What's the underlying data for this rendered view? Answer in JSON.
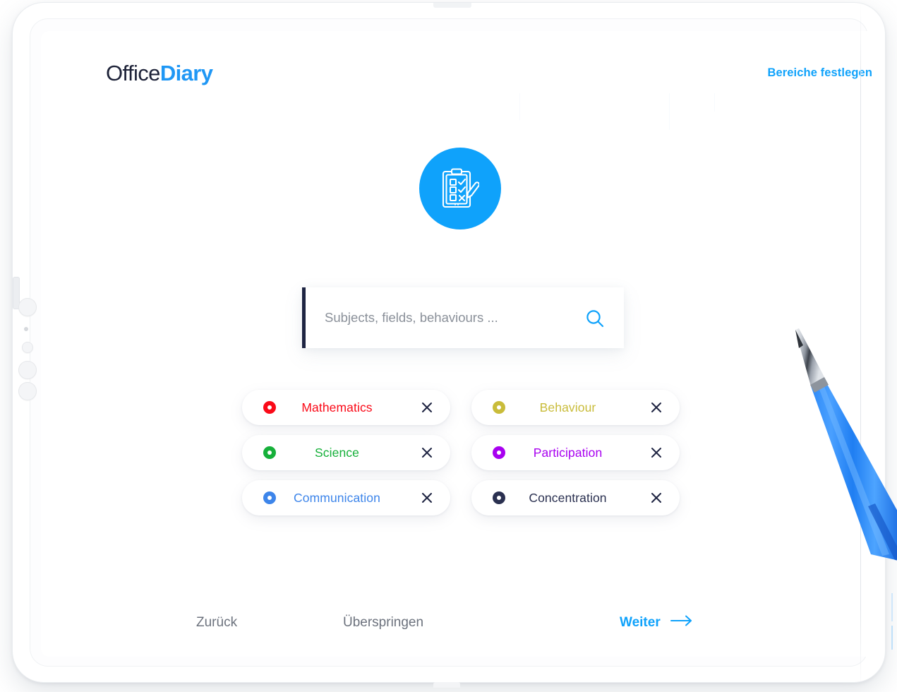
{
  "brand": {
    "logo_part1": "Office",
    "logo_part2": "Diary",
    "accent_color": "#0fa2fb",
    "logo_dark_color": "#1d2238"
  },
  "header": {
    "areas_link_label": "Bereiche festlegen"
  },
  "hero": {
    "icon_name": "clipboard-checklist-pencil-icon",
    "badge_color": "#0fa2fb",
    "badge_shadow_color": "#1565e0"
  },
  "search": {
    "placeholder": "Subjects, fields, behaviours ...",
    "value": "",
    "icon_name": "search-icon",
    "icon_color": "#0fa2fb",
    "caret_color": "#1e2442"
  },
  "chips": {
    "left_column": [
      {
        "label": "Mathematics",
        "color": "#fa0a18",
        "dot_name": "ring-dot-red-icon",
        "close_name": "close-icon"
      },
      {
        "label": "Science",
        "color": "#16b03a",
        "dot_name": "ring-dot-green-icon",
        "close_name": "close-icon"
      },
      {
        "label": "Communication",
        "color": "#3d85ea",
        "dot_name": "ring-dot-blue-icon",
        "close_name": "close-icon"
      }
    ],
    "right_column": [
      {
        "label": "Behaviour",
        "color": "#c9bc3a",
        "dot_name": "ring-dot-gold-icon",
        "close_name": "close-icon"
      },
      {
        "label": "Participation",
        "color": "#a800f0",
        "dot_name": "ring-dot-purple-icon",
        "close_name": "close-icon"
      },
      {
        "label": "Concentration",
        "color": "#2a3050",
        "dot_name": "ring-dot-navy-icon",
        "close_name": "close-icon"
      }
    ]
  },
  "bottom_nav": {
    "back_label": "Zurück",
    "skip_label": "Überspringen",
    "next_label": "Weiter",
    "next_icon_name": "arrow-right-icon"
  },
  "device": {
    "type": "tablet",
    "accessory": "blue-ballpoint-pen"
  }
}
